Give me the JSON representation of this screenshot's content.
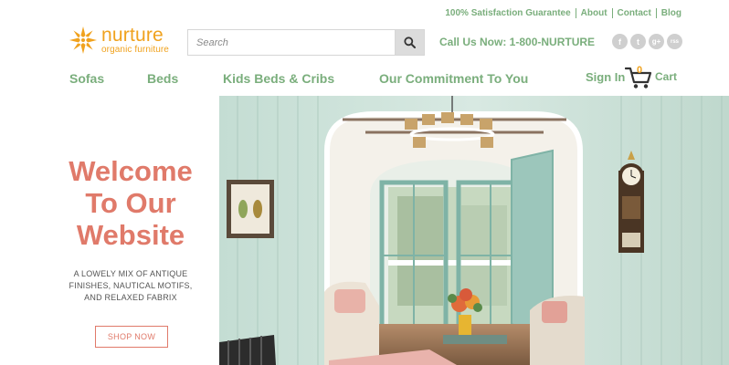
{
  "utility_links": [
    "100% Satisfaction Guarantee",
    "About",
    "Contact",
    "Blog"
  ],
  "logo": {
    "name": "nurture",
    "tagline": "organic furniture",
    "color": "#f0a21e"
  },
  "search": {
    "placeholder": "Search",
    "value": ""
  },
  "phone": "Call Us Now: 1-800-NURTURE",
  "social": [
    "f",
    "t",
    "g+",
    "rss"
  ],
  "nav": [
    "Sofas",
    "Beds",
    "Kids Beds & Cribs",
    "Our Commitment To You"
  ],
  "account": {
    "sign_in": "Sign In",
    "cart_count": "0",
    "cart_label": "Cart"
  },
  "hero": {
    "title_lines": [
      "Welcome",
      "To Our",
      "Website"
    ],
    "subtitle_lines": [
      "A LOWELY MIX OF ANTIQUE",
      "FINISHES, NAUTICAL MOTIFS,",
      "AND RELAXED FABRIX"
    ],
    "button": "SHOP NOW"
  },
  "colors": {
    "accent_green": "#7aae7c",
    "accent_coral": "#e07a6a",
    "accent_orange": "#f0a21e"
  }
}
